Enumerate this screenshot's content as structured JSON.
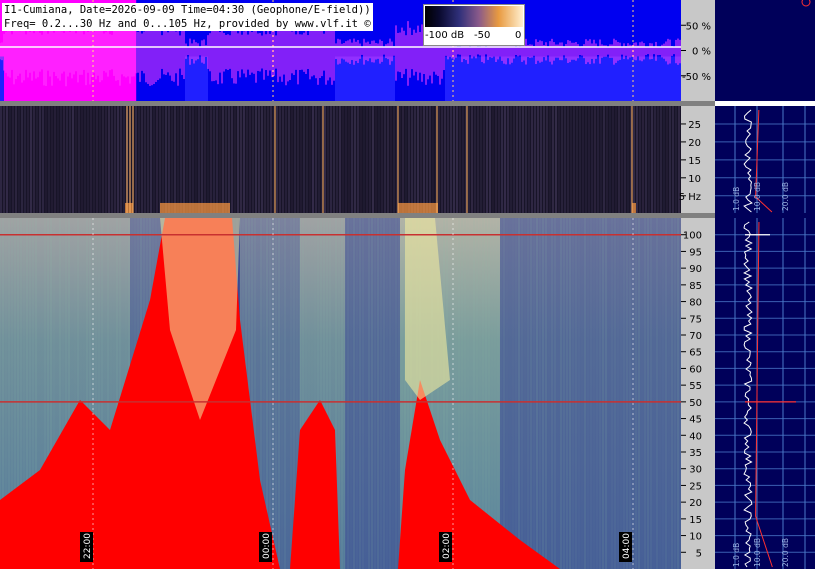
{
  "header": {
    "line1": "I1-Cumiana, Date=2026-09-09 Time=04:30 (Geophone/E-field))",
    "line2": "Freq= 0.2...30 Hz and 0...105 Hz, provided by www.vlf.it ©"
  },
  "colorbar": {
    "labels": [
      "-100 dB",
      "-50",
      "0"
    ]
  },
  "chart_data": [
    {
      "type": "line",
      "panel": "amplitude",
      "ylabel": "",
      "y_ticks": [
        "50 %",
        "0 %",
        "-50 %"
      ],
      "y_tick_values": [
        50,
        0,
        -50
      ],
      "ylim": [
        -100,
        100
      ],
      "colors": {
        "background": "#0000ff",
        "trace": "#ff00ff",
        "axis": "#ffffff"
      }
    },
    {
      "type": "heatmap",
      "panel": "spectrogram-low",
      "y_ticks": [
        "25",
        "20",
        "15",
        "10",
        "5 Hz"
      ],
      "y_tick_values": [
        25,
        20,
        15,
        10,
        5
      ],
      "ylim": [
        0.2,
        30
      ],
      "side_labels": [
        "1.0 dB",
        "10.0 dB",
        "20.0 dB"
      ],
      "colors": {
        "background": "#1a1530",
        "events": "#ff9a40"
      }
    },
    {
      "type": "heatmap",
      "panel": "spectrogram-high",
      "y_ticks": [
        "100",
        "95",
        "90",
        "85",
        "80",
        "75",
        "70",
        "65",
        "60",
        "55",
        "50",
        "45",
        "40",
        "35",
        "30",
        "25",
        "20",
        "15",
        "10",
        "5"
      ],
      "y_tick_values": [
        100,
        95,
        90,
        85,
        80,
        75,
        70,
        65,
        60,
        55,
        50,
        45,
        40,
        35,
        30,
        25,
        20,
        15,
        10,
        5
      ],
      "ylim": [
        0,
        105
      ],
      "x_ticks": [
        "22:00",
        "00:00",
        "02:00",
        "04:00"
      ],
      "side_labels": [
        "1.0 dB",
        "10.0 dB",
        "20.0 dB"
      ],
      "lines_hz": [
        100,
        50
      ],
      "colors": {
        "background": "#3a4a9a",
        "mid": "#7ab89a",
        "high": "#f0eaa0",
        "max": "#ff0000",
        "line": "#c83030"
      }
    }
  ]
}
